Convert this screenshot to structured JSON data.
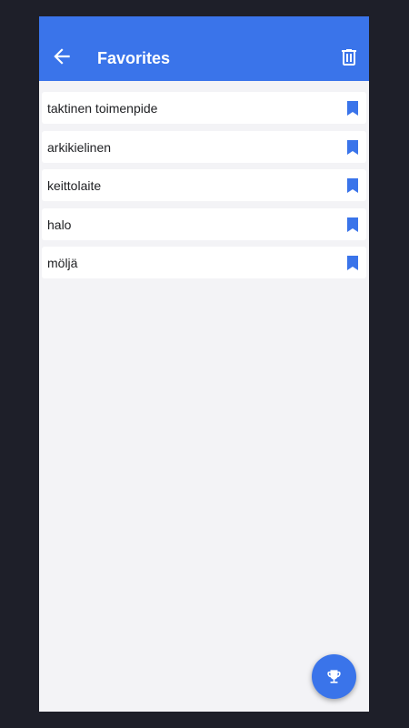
{
  "colors": {
    "accent": "#3a74ea",
    "background": "#f3f3f6",
    "outer": "#1e1f29"
  },
  "appbar": {
    "title": "Favorites",
    "back_icon": "arrow-left-icon",
    "delete_icon": "trash-icon"
  },
  "favorites": [
    {
      "label": "taktinen toimenpide",
      "icon": "bookmark-icon"
    },
    {
      "label": "arkikielinen",
      "icon": "bookmark-icon"
    },
    {
      "label": "keittolaite",
      "icon": "bookmark-icon"
    },
    {
      "label": "halo",
      "icon": "bookmark-icon"
    },
    {
      "label": "möljä",
      "icon": "bookmark-icon"
    }
  ],
  "fab": {
    "icon": "trophy-icon"
  }
}
